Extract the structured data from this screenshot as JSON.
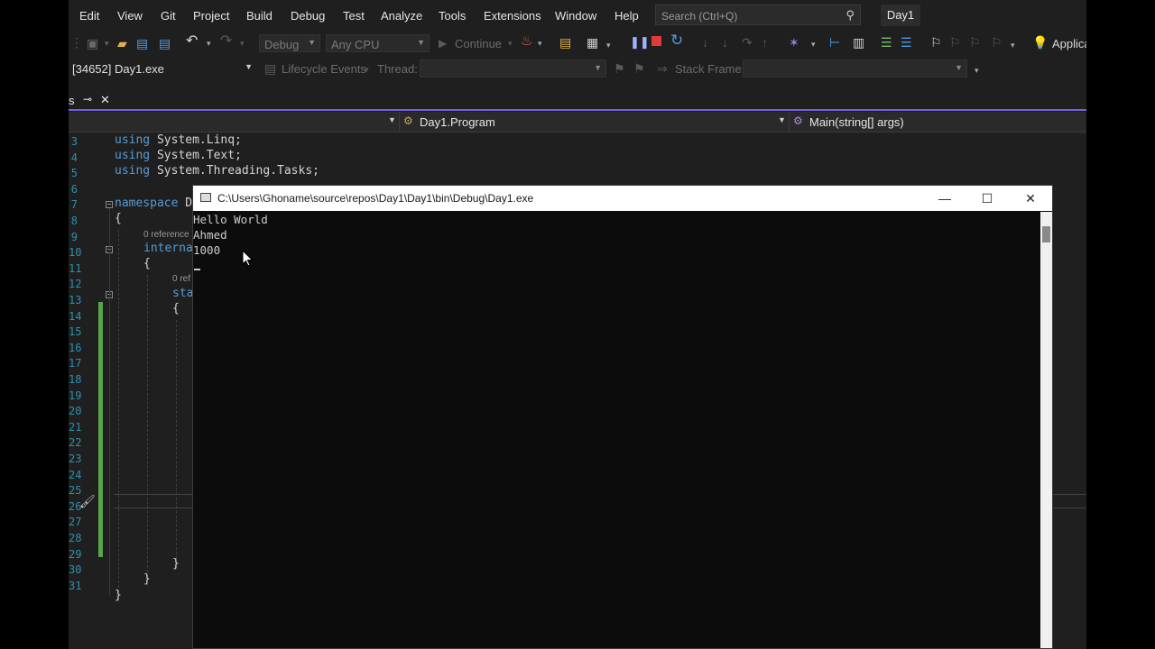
{
  "menu": [
    "Edit",
    "View",
    "Git",
    "Project",
    "Build",
    "Debug",
    "Test",
    "Analyze",
    "Tools",
    "Extensions",
    "Window",
    "Help"
  ],
  "search": {
    "placeholder": "Search (Ctrl+Q)"
  },
  "solution_name": "Day1",
  "toolbar": {
    "config": "Debug",
    "platform": "Any CPU",
    "continue_label": "Continue",
    "app_insights": "Applica"
  },
  "debug_location": {
    "process": "[34652] Day1.exe",
    "lifecycle": "Lifecycle Events",
    "thread_label": "Thread:",
    "stack_frame_label": "Stack Frame:"
  },
  "tab": {
    "label": "s",
    "pin": "⊸",
    "close": "✕"
  },
  "navbar": {
    "type": "Day1.Program",
    "member": "Main(string[] args)"
  },
  "editor": {
    "line_numbers": [
      "3",
      "4",
      "5",
      "6",
      "7",
      "8",
      "9",
      "10",
      "11",
      "12",
      "13",
      "14",
      "15",
      "16",
      "17",
      "18",
      "19",
      "20",
      "21",
      "22",
      "23",
      "24",
      "25",
      "26",
      "27",
      "28",
      "29",
      "30",
      "31"
    ],
    "using1_kw": "using",
    "using1": "System.Linq;",
    "using2_kw": "using",
    "using2": "System.Text;",
    "using3_kw": "using",
    "using3": "System.Threading.Tasks;",
    "namespace_kw": "namespace",
    "namespace_rest": "D",
    "brace_open": "{",
    "ref1": "0 reference",
    "internal_kw": "interna",
    "brace_open2": "{",
    "ref2": "0 ref",
    "static_kw": "sta",
    "brace_open3": "{",
    "brace_close3": "}",
    "brace_close2": "}",
    "brace_close1": "}"
  },
  "console": {
    "title": "C:\\Users\\Ghoname\\source\\repos\\Day1\\Day1\\bin\\Debug\\Day1.exe",
    "output": [
      "Hello World",
      "Ahmed",
      "1000"
    ],
    "minimize": "—",
    "maximize": "☐",
    "close": "✕"
  },
  "colors": {
    "accent": "#7160e8",
    "keyword": "#569cd6",
    "line_number": "#2b91af",
    "change_bar": "#57a64a"
  }
}
